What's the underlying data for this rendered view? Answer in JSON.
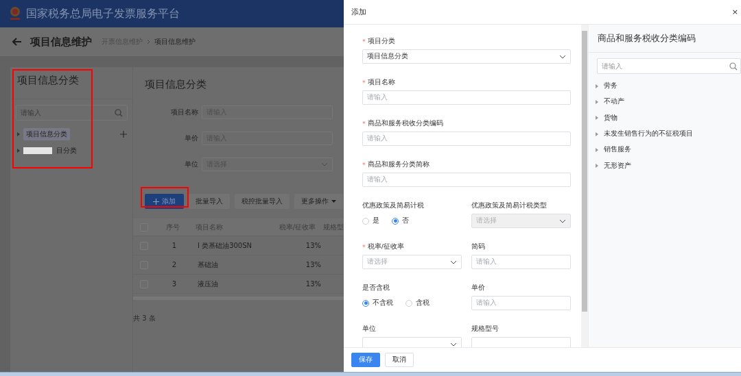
{
  "header": {
    "title": "国家税务总局电子发票服务平台"
  },
  "page": {
    "title": "项目信息维护",
    "breadcrumb": [
      {
        "label": "开票信息维护",
        "current": false
      },
      {
        "label": "项目信息维护",
        "current": true
      }
    ]
  },
  "category_panel": {
    "title": "项目信息分类",
    "search": {
      "placeholder": "请输入"
    },
    "tree": [
      {
        "label": "项目信息分类",
        "selected": true,
        "redacted": false
      },
      {
        "label": "目分类",
        "selected": false,
        "redacted": true
      }
    ]
  },
  "content": {
    "title": "项目信息分类",
    "filters": [
      {
        "label": "项目名称",
        "kind": "input",
        "placeholder": "请输入"
      },
      {
        "label": "单价",
        "kind": "input",
        "placeholder": "请输入"
      },
      {
        "label": "单位",
        "kind": "select",
        "placeholder": "请选择"
      }
    ],
    "buttons": [
      {
        "label": "添加",
        "kind": "primary"
      },
      {
        "label": "批量导入",
        "kind": "plain"
      },
      {
        "label": "税控批量导入",
        "kind": "plain"
      },
      {
        "label": "更多操作",
        "kind": "dropdown"
      }
    ],
    "table": {
      "all_checked": false,
      "columns": [
        "序号",
        "项目名称",
        "税率/征收率",
        "规格型"
      ],
      "rows": [
        {
          "checked": false,
          "cells": [
            "1",
            "I 类基础油300SN",
            "13%"
          ]
        },
        {
          "checked": false,
          "cells": [
            "2",
            "基础油",
            "13%"
          ]
        },
        {
          "checked": false,
          "cells": [
            "3",
            "液压油",
            "13%"
          ]
        }
      ]
    },
    "total": "共 3 条"
  },
  "drawer": {
    "title": "添加",
    "close": "×",
    "full_fields": [
      {
        "label": "项目分类",
        "mark": "*",
        "kind": "select",
        "value": "项目信息分类",
        "disabled": false
      },
      {
        "label": "项目名称",
        "mark": "*",
        "kind": "input",
        "placeholder": "请输入",
        "disabled": false
      },
      {
        "label": "商品和服务税收分类编码",
        "mark": "*",
        "kind": "input",
        "placeholder": "请输入",
        "disabled": false
      },
      {
        "label": "商品和服务分类简称",
        "mark": "*",
        "kind": "input",
        "placeholder": "请输入",
        "disabled": false
      }
    ],
    "paired_fields": [
      {
        "label": "优惠政策及简易计税",
        "kind": "radio",
        "options": [
          {
            "label": "是",
            "selected": false
          },
          {
            "label": "否",
            "selected": true
          }
        ]
      },
      {
        "label": "优惠政策及简易计税类型",
        "kind": "select",
        "placeholder": "请选择",
        "disabled": true
      },
      {
        "label": "税率/征收率",
        "mark": "*",
        "kind": "select",
        "placeholder": "请选择",
        "disabled": false
      },
      {
        "label": "简码",
        "kind": "input",
        "placeholder": "请输入",
        "disabled": false
      },
      {
        "label": "是否含税",
        "kind": "radio",
        "options": [
          {
            "label": "不含税",
            "selected": true
          },
          {
            "label": "含税",
            "selected": false
          }
        ]
      },
      {
        "label": "单价",
        "kind": "input",
        "placeholder": "请输入",
        "disabled": false
      },
      {
        "label": "单位",
        "kind": "select",
        "disabled": false
      },
      {
        "label": "规格型号",
        "kind": "input",
        "disabled": false
      }
    ],
    "buttons": [
      {
        "label": "保存",
        "kind": "primary"
      },
      {
        "label": "取消",
        "kind": "plain"
      }
    ],
    "code_panel": {
      "title": "商品和服务税收分类编码",
      "search": {
        "placeholder": "请输入"
      },
      "tree": [
        {
          "label": "劳务"
        },
        {
          "label": "不动产"
        },
        {
          "label": "货物"
        },
        {
          "label": "未发生销售行为的不征税项目"
        },
        {
          "label": "销售服务"
        },
        {
          "label": "无形资产"
        }
      ]
    }
  }
}
